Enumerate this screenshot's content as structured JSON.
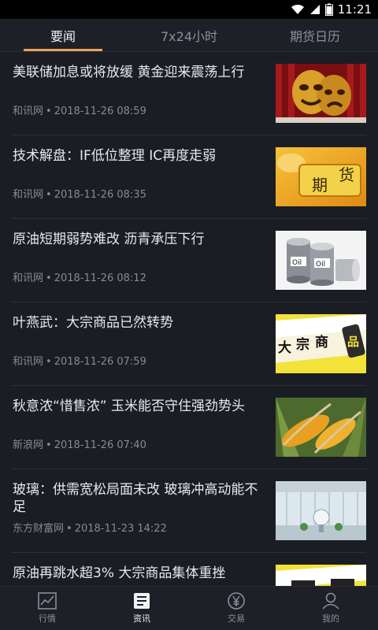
{
  "status": {
    "time": "11:21"
  },
  "tabs": [
    {
      "label": "要闻",
      "active": true
    },
    {
      "label": "7x24小时",
      "active": false
    },
    {
      "label": "期货日历",
      "active": false
    }
  ],
  "news": [
    {
      "title": "美联储加息或将放缓 黄金迎来震荡上行",
      "source": "和讯网",
      "time": "2018-11-26 08:59",
      "thumb": "theatre-masks"
    },
    {
      "title": "技术解盘：IF低位整理 IC再度走弱",
      "source": "和讯网",
      "time": "2018-11-26 08:35",
      "thumb": "futures-banner"
    },
    {
      "title": "原油短期弱势难改 沥青承压下行",
      "source": "和讯网",
      "time": "2018-11-26 08:12",
      "thumb": "oil-barrels"
    },
    {
      "title": "叶燕武：大宗商品已然转势",
      "source": "和讯网",
      "time": "2018-11-26 07:59",
      "thumb": "commodity-banner",
      "thumb_text": [
        "大",
        "宗",
        "商",
        "品"
      ]
    },
    {
      "title": "秋意浓“惜售浓” 玉米能否守住强劲势头",
      "source": "新浪网",
      "time": "2018-11-26 07:40",
      "thumb": "corn"
    },
    {
      "title": "玻璃：供需宽松局面未改 玻璃冲高动能不足",
      "source": "东方财富网",
      "time": "2018-11-23 14:22",
      "thumb": "glass-building"
    },
    {
      "title": "原油再跳水超3% 大宗商品集体重挫",
      "source": "",
      "time": "",
      "thumb": "commodity-banner"
    }
  ],
  "bottom_nav": [
    {
      "label": "行情",
      "icon": "chart-line-icon",
      "active": false
    },
    {
      "label": "资讯",
      "icon": "news-icon",
      "active": true
    },
    {
      "label": "交易",
      "icon": "yen-coin-icon",
      "active": false
    },
    {
      "label": "我的",
      "icon": "person-icon",
      "active": false
    }
  ],
  "colors": {
    "accent": "#e8a25c",
    "background": "#1b1d24"
  }
}
